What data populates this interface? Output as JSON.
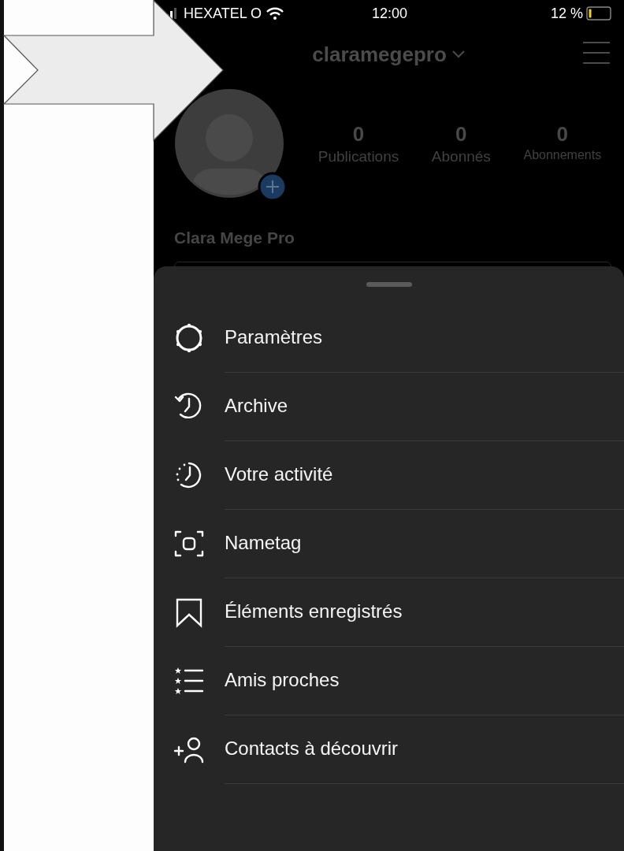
{
  "status_bar": {
    "carrier": "HEXATEL O",
    "time": "12:00",
    "battery": "12 %"
  },
  "header": {
    "username": "claramegepro"
  },
  "profile": {
    "stats": [
      {
        "value": "0",
        "label": "Publications"
      },
      {
        "value": "0",
        "label": "Abonnés"
      },
      {
        "value": "0",
        "label": "Abonnements"
      }
    ],
    "name": "Clara Mege Pro"
  },
  "menu": {
    "items": [
      {
        "kind": "settings",
        "label": "Paramètres"
      },
      {
        "kind": "archive",
        "label": "Archive"
      },
      {
        "kind": "activity",
        "label": "Votre activité"
      },
      {
        "kind": "nametag",
        "label": "Nametag"
      },
      {
        "kind": "saved",
        "label": "Éléments enregistrés"
      },
      {
        "kind": "friends",
        "label": "Amis proches"
      },
      {
        "kind": "discover",
        "label": "Contacts à découvrir"
      }
    ]
  }
}
